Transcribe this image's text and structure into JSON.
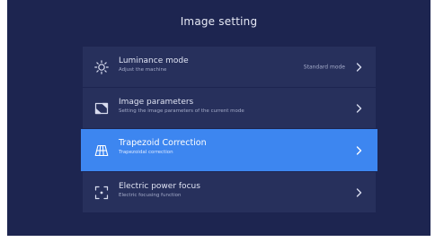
{
  "screen": {
    "title": "Image setting"
  },
  "menu": {
    "items": [
      {
        "icon": "sun-icon",
        "title": "Luminance mode",
        "subtitle": "Adjust the machine",
        "value": "Standard mode",
        "selected": false
      },
      {
        "icon": "picture-icon",
        "title": "Image parameters",
        "subtitle": "Setting the image parameters of the current mode",
        "value": "",
        "selected": false
      },
      {
        "icon": "keystone-grid-icon",
        "title": "Trapezoid Correction",
        "subtitle": "Trapezoidal correction",
        "value": "",
        "selected": true
      },
      {
        "icon": "focus-icon",
        "title": "Electric power focus",
        "subtitle": "Electric focusing function",
        "value": "",
        "selected": false
      }
    ]
  },
  "colors": {
    "background": "#1d2550",
    "item": "#27305c",
    "selected": "#3d86f0"
  }
}
